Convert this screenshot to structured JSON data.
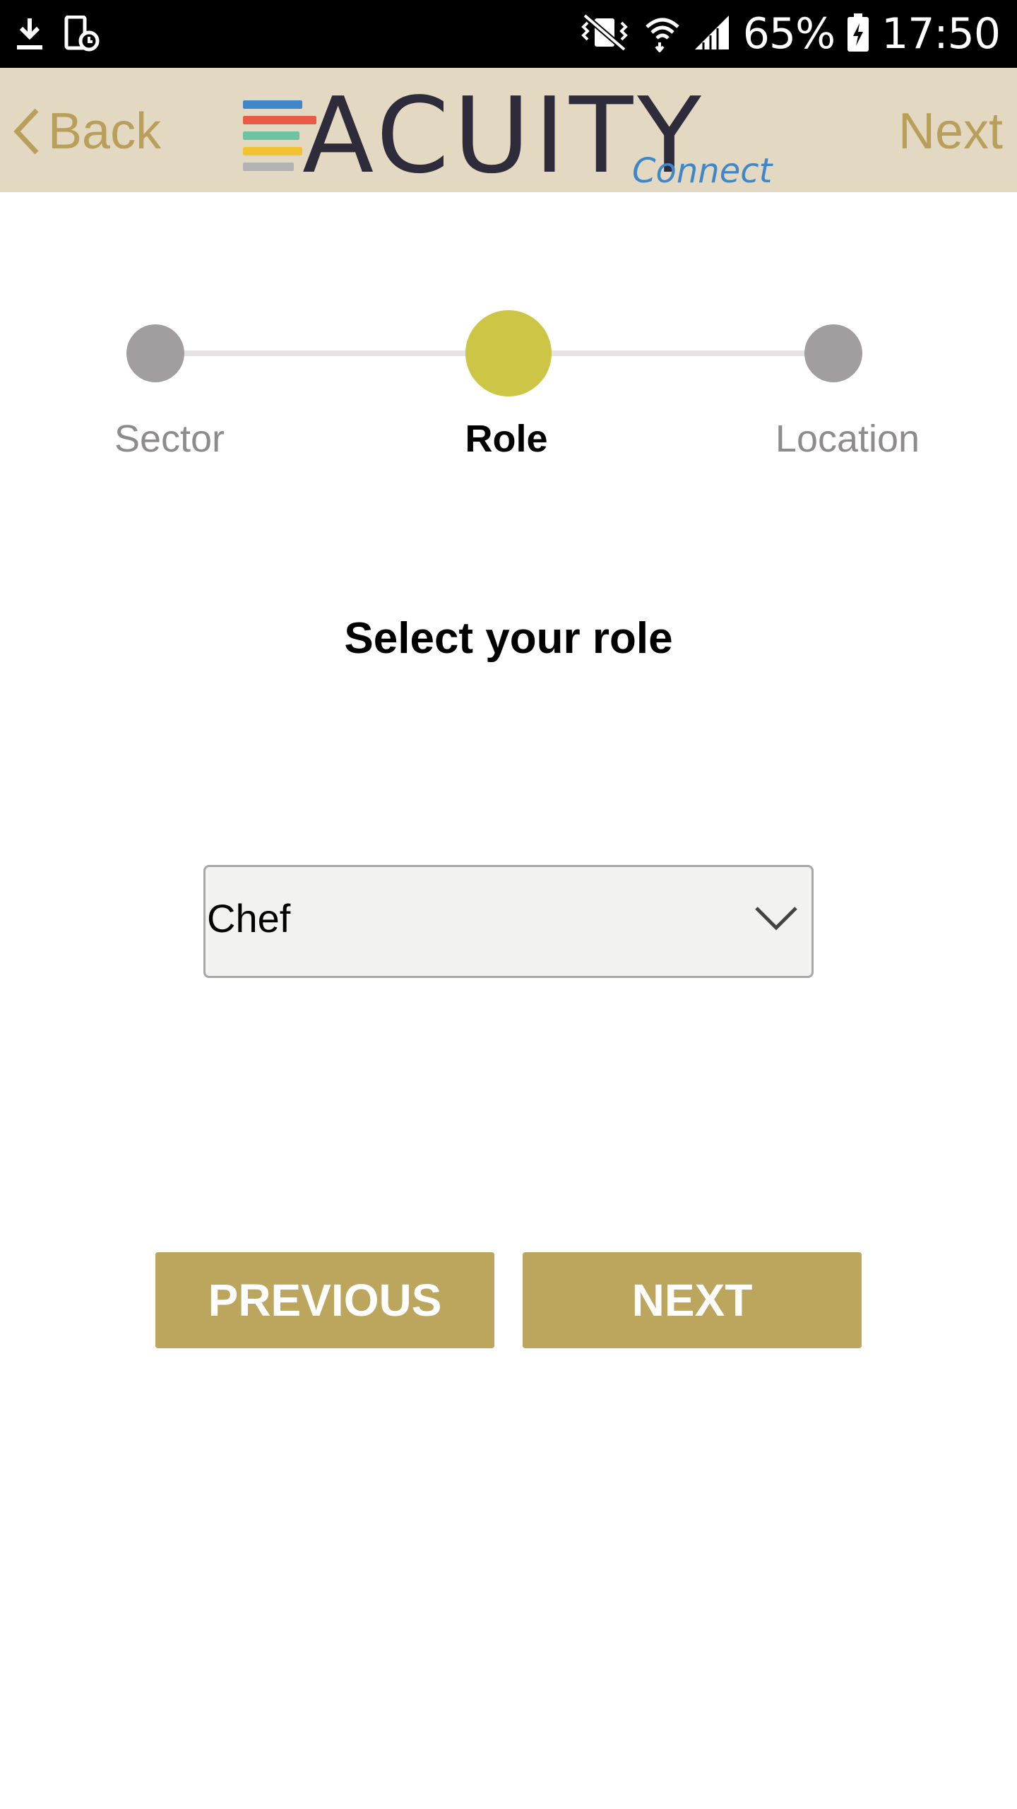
{
  "status_bar": {
    "battery": "65%",
    "time": "17:50",
    "icons": [
      "download-icon",
      "screenshot-icon",
      "vibrate-mute-icon",
      "wifi-icon",
      "cell-signal-icon",
      "battery-charging-icon"
    ]
  },
  "header": {
    "back_label": "Back",
    "next_label": "Next",
    "logo_text": "ACUITY",
    "logo_subtext": "Connect",
    "colors": {
      "background": "#e3d9c2",
      "accent": "#b8a05a"
    }
  },
  "stepper": {
    "steps": [
      {
        "label": "Sector",
        "state": "inactive"
      },
      {
        "label": "Role",
        "state": "active"
      },
      {
        "label": "Location",
        "state": "inactive"
      }
    ],
    "colors": {
      "active": "#cdc545",
      "inactive": "#a29e9f"
    }
  },
  "main": {
    "prompt": "Select your role",
    "role_select": {
      "value": "Chef"
    }
  },
  "actions": {
    "previous_label": "PREVIOUS",
    "next_label": "NEXT",
    "color": "#bca55c"
  }
}
